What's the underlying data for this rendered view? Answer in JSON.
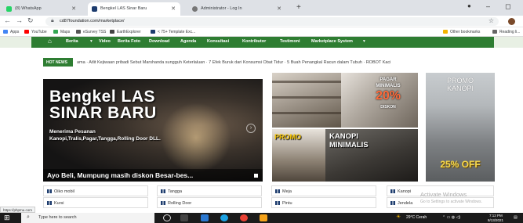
{
  "browser": {
    "tabs": [
      {
        "label": "(8) WhatsApp",
        "color": "#25d366"
      },
      {
        "label": "Bengkel LAS Sinar Baru",
        "color": "#1d3c6e"
      },
      {
        "label": "Administrator - Log In",
        "color": "#777777"
      }
    ],
    "url": "cd87foundation.com/marketplace/",
    "bookmarks": [
      {
        "label": "Apps",
        "color": "#4285f4"
      },
      {
        "label": "YouTube",
        "color": "#ff0000"
      },
      {
        "label": "Maps",
        "color": "#34a853"
      },
      {
        "label": "eSurvey TSS",
        "color": "#555555"
      },
      {
        "label": "EarthExplorer",
        "color": "#444444"
      },
      {
        "label": "< 75+ Template Exc...",
        "color": "#1d3c6e"
      },
      {
        "label": "Other bookmarks",
        "color": "#f4b400"
      },
      {
        "label": "Reading li...",
        "color": "#666666"
      }
    ]
  },
  "site": {
    "nav": [
      "Berita",
      "Video",
      "Berita Foto",
      "Download",
      "Agenda",
      "Konsultasi",
      "Kontributor",
      "Testimoni",
      "Marketplace System"
    ],
    "hot_news_label": "HOT NEWS",
    "ticker": "ama  ·  Atlit Kejiwaan pribadi Sebut Marshanda sungguh Keterlaluan  ·  7 Efek Buruk dari Konsumsi Obat Tidur  ·  5 Buah Penangkal Racun dalam Tubuh  ·  ROBOT Kaci",
    "slider": {
      "title_line1": "Bengkel LAS",
      "title_line2": "SINAR BARU",
      "sub1": "Menerima Pesanan",
      "sub2": "Kanopi,Tralis,Pagar,Tangga,Rolling Door DLL.",
      "caption": "Ayo Beli, Mumpung masih diskon Besar-bes..."
    },
    "promo_a": {
      "line1": "PAGAR",
      "line2": "MINIMALIS",
      "pct": "20%",
      "line3": "DISKON"
    },
    "promo_c": {
      "line1": "PROMO"
    },
    "promo_d": {
      "line1": "KANOPI",
      "line2": "MINIMALIS"
    },
    "promo_e": {
      "line1": "PROMO",
      "line2": "KANOPI",
      "off": "25% OFF"
    },
    "categories": [
      "Oiko mobil",
      "Tangga",
      "Meja",
      "Kanopi",
      "Kursi",
      "Rolling Door",
      "Pintu",
      "Jendela"
    ],
    "watermark": {
      "line1": "Activate Windows",
      "line2": "Go to Settings to activate Windows."
    }
  },
  "status_url": "https://phpmu.com",
  "taskbar": {
    "search_placeholder": "Type here to search",
    "weather": "29°C Cerah",
    "time": "7:12 PM",
    "date": "8/13/2021"
  },
  "colors": {
    "accent": "#2e7d32",
    "brand": "#1d3c6e"
  }
}
